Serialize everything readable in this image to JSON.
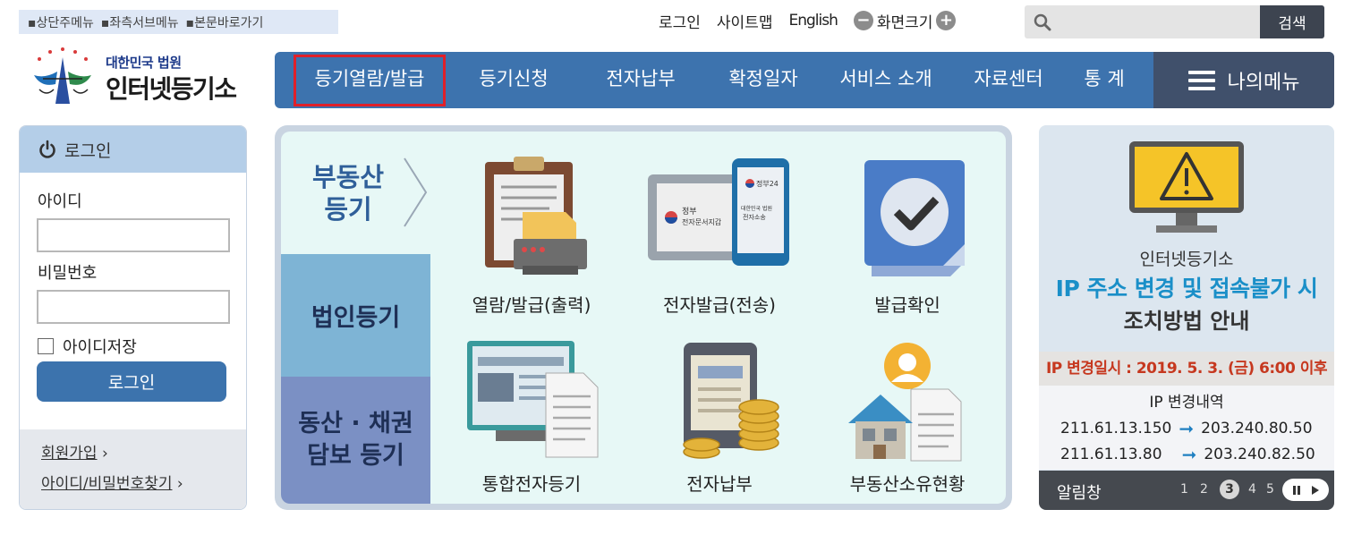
{
  "skip_links": [
    "▪상단주메뉴",
    "▪좌측서브메뉴",
    "▪본문바로가기"
  ],
  "util": {
    "login": "로그인",
    "sitemap": "사이트맵",
    "english": "English",
    "zoom_label": "화면크기",
    "zoom_out": "−",
    "zoom_in": "+"
  },
  "search": {
    "placeholder": "",
    "button": "검색"
  },
  "logo": {
    "line1": "대한민국 법원",
    "line2": "인터넷등기소"
  },
  "gnb": {
    "items": [
      "등기열람/발급",
      "등기신청",
      "전자납부",
      "확정일자",
      "서비스 소개",
      "자료센터",
      "통 계"
    ],
    "active": "등기열람/발급",
    "mymenu": "나의메뉴"
  },
  "login": {
    "title": "로그인",
    "id_label": "아이디",
    "pw_label": "비밀번호",
    "save_id": "아이디저장",
    "button": "로그인",
    "join": "회원가입",
    "find": "아이디/비밀번호찾기",
    "chevron": "›"
  },
  "main": {
    "categories": {
      "real_estate_1": "부동산",
      "real_estate_2": "등기",
      "corporate": "법인등기",
      "movable_1": "동산 · 채권",
      "movable_2": "담보 등기"
    },
    "services": [
      {
        "label": "열람/발급(출력)",
        "icon": "clipboard-print-icon"
      },
      {
        "label": "전자발급(전송)",
        "icon": "tablet-phone-icon"
      },
      {
        "label": "발급확인",
        "icon": "checkmark-icon"
      },
      {
        "label": "통합전자등기",
        "icon": "monitor-document-icon"
      },
      {
        "label": "전자납부",
        "icon": "tablet-coins-icon"
      },
      {
        "label": "부동산소유현황",
        "icon": "house-person-icon"
      }
    ],
    "tablet_text": "정부\n전자문서지갑",
    "phone_text_1": "정부24",
    "phone_text_2": "대한민국 법원\n전자소송"
  },
  "notice": {
    "line1": "인터넷등기소",
    "line2": "IP 주소 변경 및 접속불가 시",
    "line3": "조치방법 안내",
    "date": "IP 변경일시 : 2019. 5. 3. (금) 6:00 이후",
    "history_title": "IP 변경내역",
    "ips": [
      {
        "from": "211.61.13.150",
        "to": "203.240.80.50"
      },
      {
        "from": "211.61.13.80",
        "to": "203.240.82.50"
      }
    ],
    "bar_title": "알림창",
    "pages": [
      "1",
      "2",
      "3",
      "4",
      "5"
    ],
    "current_page": "3"
  },
  "colors": {
    "gnb": "#3d73ae",
    "mymenu": "#40506b",
    "active_outline": "#e0202a",
    "accent_blue": "#1a8fc8",
    "date_red": "#c6381f"
  }
}
